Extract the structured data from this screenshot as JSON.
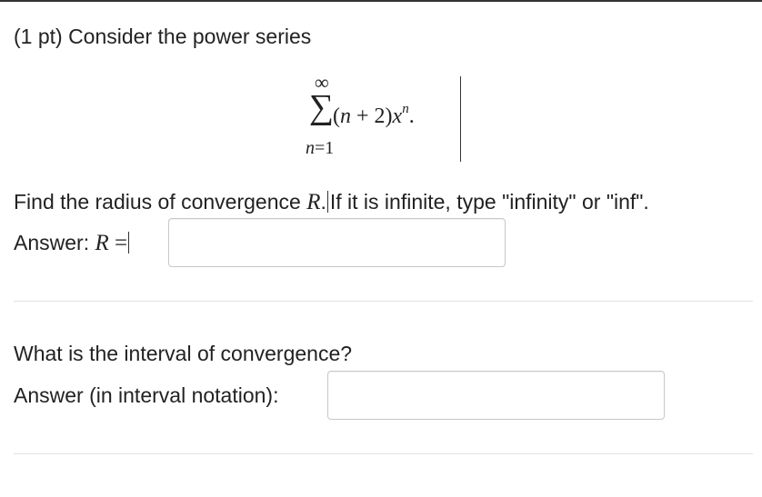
{
  "problem": {
    "intro": "(1 pt) Consider the power series"
  },
  "series": {
    "upper": "∞",
    "sigma": "∑",
    "summand_prefix": "(",
    "summand_var1": "n",
    "summand_middle": " + 2)",
    "summand_var2": "x",
    "summand_exp": "n",
    "summand_end": ".",
    "lower_var": "n",
    "lower_rest": "=1"
  },
  "radius": {
    "question_before": "Find the radius of convergence ",
    "question_var": "R",
    "question_dot": ".",
    "question_after": "If it is infinite, type \"infinity\" or \"inf\".",
    "answer_label": "Answer: ",
    "answer_var": "R",
    "answer_eq": " =",
    "input_value": ""
  },
  "interval": {
    "question": "What is the interval of convergence?",
    "answer_label": "Answer (in interval notation):",
    "input_value": ""
  }
}
